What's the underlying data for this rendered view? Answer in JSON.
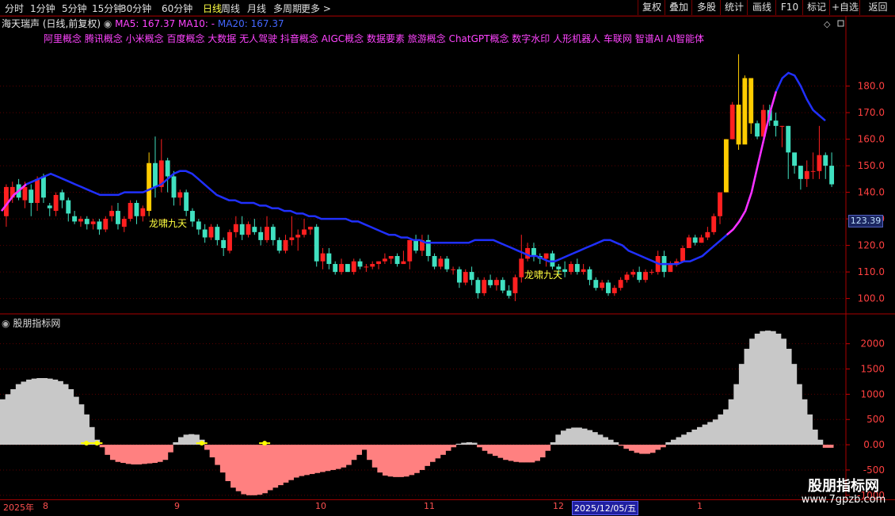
{
  "toolbar": {
    "periods": [
      "分时",
      "1分钟",
      "5分钟",
      "15分钟",
      "30分钟",
      "60分钟",
      "日线",
      "周线",
      "月线",
      "多周期",
      "更多"
    ],
    "active_period": "日线",
    "tools": [
      "复权",
      "叠加",
      "多股",
      "统计",
      "画线",
      "F10",
      "标记",
      "+自选",
      "返回"
    ]
  },
  "header": {
    "stock_name": "海天瑞声",
    "mode": "(日线,前复权)",
    "ma5": "MA5: 167.37",
    "ma10": "MA10: -",
    "ma20": "MA20: 167.37"
  },
  "concepts": "阿里概念 腾讯概念 小米概念 百度概念 大数据 无人驾驶 抖音概念 AIGC概念 数据要素 旅游概念 ChatGPT概念 数字水印 人形机器人 车联网 智谱AI AI智能体",
  "current_price_label": "123.39",
  "annotations": [
    "龙啸九天",
    "龙啸九天"
  ],
  "indicator_title": "股朋指标网",
  "date_axis": {
    "labels": [
      "2025年",
      "8",
      "9",
      "10",
      "11",
      "12",
      "2025/12/05/五",
      "1"
    ],
    "selected": "2025/12/05/五"
  },
  "watermark": {
    "title": "股朋指标网",
    "url": "www.7gpzb.com"
  },
  "chart_data": [
    {
      "type": "candlestick",
      "y_ticks": [
        100,
        110,
        120,
        130,
        140,
        150,
        160,
        170,
        180
      ],
      "y_tick_labels": [
        "100.0",
        "110.0",
        "120.0",
        "130.0",
        "140.0",
        "150.0",
        "160.0",
        "170.0",
        "180.0"
      ],
      "ylim": [
        96,
        196
      ],
      "ma_line": [
        133,
        136,
        139,
        141,
        143,
        144,
        145,
        146,
        147,
        146,
        145,
        144,
        143,
        142,
        141,
        140,
        139,
        139,
        139,
        139,
        140,
        140,
        140,
        140,
        141,
        142,
        143,
        145,
        147,
        148,
        148,
        147,
        145,
        143,
        141,
        139,
        138,
        137,
        137,
        136,
        136,
        136,
        135,
        135,
        134,
        134,
        133,
        133,
        132,
        132,
        131,
        131,
        130,
        130,
        130,
        130,
        130,
        129,
        129,
        128,
        127,
        126,
        125,
        124,
        124,
        123,
        123,
        122,
        122,
        121,
        121,
        121,
        121,
        121,
        121,
        121,
        121,
        122,
        122,
        122,
        122,
        121,
        120,
        119,
        118,
        117,
        116,
        116,
        115,
        114,
        114,
        115,
        116,
        117,
        118,
        119,
        120,
        121,
        122,
        122,
        121,
        120,
        118,
        117,
        116,
        115,
        114,
        113,
        113,
        113,
        113,
        114,
        114,
        115,
        116,
        118,
        120,
        122,
        124,
        126,
        129,
        133,
        140,
        150,
        160,
        170,
        178,
        183,
        185,
        184,
        180,
        175,
        171,
        169,
        167
      ],
      "candles": [
        [
          131,
          142,
          127,
          143
        ],
        [
          138,
          142,
          136,
          144
        ],
        [
          143,
          138,
          137,
          145
        ],
        [
          137,
          142,
          134,
          144
        ],
        [
          141,
          136,
          131,
          143
        ],
        [
          136,
          145,
          133,
          146
        ],
        [
          146,
          138,
          136,
          147
        ],
        [
          135,
          134,
          131,
          136
        ],
        [
          133,
          139,
          131,
          140
        ],
        [
          140,
          137,
          134,
          141
        ],
        [
          137,
          132,
          129,
          138
        ],
        [
          131,
          129,
          128,
          133
        ],
        [
          129,
          130,
          127,
          131
        ],
        [
          130,
          128,
          126,
          131
        ],
        [
          128,
          129,
          126,
          130
        ],
        [
          129,
          126,
          124,
          130
        ],
        [
          126,
          130,
          125,
          131
        ],
        [
          131,
          133,
          129,
          135
        ],
        [
          133,
          128,
          126,
          136
        ],
        [
          127,
          130,
          125,
          131
        ],
        [
          130,
          136,
          129,
          137
        ],
        [
          136,
          131,
          128,
          137
        ],
        [
          131,
          134,
          129,
          135
        ],
        [
          133,
          151,
          131,
          155
        ],
        [
          151,
          142,
          138,
          161
        ],
        [
          142,
          152,
          140,
          160
        ],
        [
          152,
          146,
          140,
          153
        ],
        [
          146,
          138,
          135,
          148
        ],
        [
          138,
          140,
          135,
          141
        ],
        [
          140,
          133,
          131,
          141
        ],
        [
          133,
          129,
          127,
          134
        ],
        [
          129,
          126,
          124,
          130
        ],
        [
          126,
          123,
          121,
          128
        ],
        [
          123,
          127,
          122,
          128
        ],
        [
          127,
          122,
          120,
          128
        ],
        [
          122,
          119,
          116,
          123
        ],
        [
          118,
          125,
          117,
          126
        ],
        [
          125,
          128,
          123,
          131
        ],
        [
          128,
          124,
          122,
          131
        ],
        [
          124,
          128,
          123,
          129
        ],
        [
          127,
          125,
          124,
          130
        ],
        [
          125,
          122,
          120,
          127
        ],
        [
          122,
          127,
          121,
          131
        ],
        [
          127,
          122,
          120,
          128
        ],
        [
          122,
          118,
          117,
          123
        ],
        [
          118,
          122,
          117,
          124
        ],
        [
          122,
          123,
          120,
          131
        ],
        [
          123,
          124,
          118,
          126
        ],
        [
          124,
          126,
          123,
          130
        ],
        [
          126,
          127,
          124,
          127
        ],
        [
          127,
          114,
          112,
          128
        ],
        [
          114,
          117,
          111,
          119
        ],
        [
          117,
          113,
          111,
          119
        ],
        [
          113,
          110,
          109,
          114
        ],
        [
          110,
          113,
          109,
          115
        ],
        [
          113,
          110,
          110,
          112
        ],
        [
          110,
          114,
          109,
          115
        ],
        [
          114,
          112,
          111,
          115
        ],
        [
          112,
          112,
          110,
          113
        ],
        [
          112,
          113,
          111,
          114
        ],
        [
          113,
          114,
          111,
          114
        ],
        [
          114,
          115,
          113,
          117
        ],
        [
          115,
          116,
          113,
          116
        ],
        [
          116,
          113,
          112,
          117
        ],
        [
          113,
          114,
          113,
          118
        ],
        [
          114,
          122,
          111,
          122
        ],
        [
          122,
          118,
          117,
          124
        ],
        [
          118,
          122,
          116,
          124
        ],
        [
          122,
          116,
          114,
          124
        ],
        [
          116,
          112,
          111,
          117
        ],
        [
          112,
          115,
          111,
          116
        ],
        [
          115,
          111,
          110,
          116
        ],
        [
          111,
          111,
          109,
          112
        ],
        [
          111,
          106,
          104,
          112
        ],
        [
          106,
          110,
          105,
          111
        ],
        [
          110,
          107,
          105,
          112
        ],
        [
          107,
          102,
          100,
          108
        ],
        [
          102,
          107,
          101,
          108
        ],
        [
          107,
          105,
          104,
          109
        ],
        [
          105,
          107,
          103,
          108
        ],
        [
          107,
          103,
          102,
          108
        ],
        [
          103,
          101,
          100,
          105
        ],
        [
          102,
          108,
          99,
          109
        ],
        [
          108,
          115,
          106,
          124
        ],
        [
          115,
          119,
          114,
          121
        ],
        [
          119,
          116,
          114,
          121
        ],
        [
          116,
          115,
          113,
          117
        ],
        [
          115,
          117,
          112,
          117
        ],
        [
          117,
          112,
          111,
          118
        ],
        [
          112,
          111,
          109,
          113
        ],
        [
          111,
          110,
          108,
          114
        ],
        [
          110,
          113,
          109,
          114
        ],
        [
          113,
          110,
          109,
          115
        ],
        [
          110,
          111,
          109,
          113
        ],
        [
          111,
          107,
          105,
          112
        ],
        [
          107,
          104,
          103,
          108
        ],
        [
          104,
          106,
          103,
          107
        ],
        [
          106,
          102,
          101,
          107
        ],
        [
          102,
          104,
          101,
          105
        ],
        [
          104,
          107,
          103,
          108
        ],
        [
          107,
          109,
          106,
          110
        ],
        [
          109,
          110,
          108,
          111
        ],
        [
          110,
          107,
          106,
          112
        ],
        [
          107,
          110,
          106,
          111
        ],
        [
          110,
          110,
          109,
          111
        ],
        [
          110,
          116,
          109,
          118
        ],
        [
          116,
          110,
          108,
          118
        ],
        [
          110,
          113,
          110,
          114
        ],
        [
          113,
          114,
          112,
          115
        ],
        [
          114,
          119,
          114,
          120
        ],
        [
          119,
          123,
          119,
          124
        ],
        [
          123,
          121,
          120,
          124
        ],
        [
          121,
          123,
          121,
          124
        ],
        [
          123,
          125,
          122,
          127
        ],
        [
          125,
          131,
          124,
          132
        ],
        [
          131,
          140,
          128,
          132
        ],
        [
          140,
          160,
          140,
          160
        ],
        [
          160,
          173,
          160,
          174
        ],
        [
          173,
          158,
          156,
          192
        ],
        [
          158,
          183,
          160,
          184
        ],
        [
          183,
          166,
          162,
          171
        ],
        [
          166,
          161,
          160,
          167
        ],
        [
          161,
          171,
          160,
          173
        ],
        [
          171,
          167,
          165,
          173
        ],
        [
          167,
          165,
          161,
          170
        ],
        [
          165,
          165,
          157,
          165
        ],
        [
          165,
          155,
          145,
          165
        ],
        [
          155,
          150,
          147,
          154
        ],
        [
          150,
          145,
          141,
          150
        ],
        [
          145,
          148,
          142,
          152
        ],
        [
          148,
          148,
          145,
          155
        ],
        [
          148,
          154,
          145,
          165
        ],
        [
          154,
          150,
          145,
          155
        ],
        [
          150,
          143,
          142,
          155
        ]
      ]
    },
    {
      "type": "histogram",
      "y_ticks": [
        -1000,
        -500,
        0,
        500,
        1000,
        1500,
        2000
      ],
      "y_tick_labels": [
        "-1000",
        "-500",
        "0.00",
        "500",
        "1000",
        "1500",
        "2000"
      ],
      "ylim": [
        -1050,
        2450
      ],
      "values": [
        900,
        1000,
        1100,
        1200,
        1250,
        1290,
        1310,
        1320,
        1320,
        1310,
        1290,
        1260,
        1200,
        1100,
        950,
        800,
        600,
        350,
        100,
        -50,
        -200,
        -300,
        -340,
        -360,
        -380,
        -390,
        -390,
        -380,
        -370,
        -360,
        -340,
        -300,
        -150,
        50,
        150,
        200,
        210,
        200,
        100,
        -100,
        -250,
        -400,
        -550,
        -720,
        -850,
        -920,
        -980,
        -1000,
        -1000,
        -990,
        -960,
        -900,
        -850,
        -800,
        -750,
        -700,
        -650,
        -620,
        -600,
        -580,
        -560,
        -540,
        -520,
        -500,
        -480,
        -450,
        -400,
        -300,
        -200,
        -100,
        -300,
        -450,
        -550,
        -610,
        -630,
        -640,
        -640,
        -630,
        -600,
        -560,
        -500,
        -420,
        -340,
        -270,
        -200,
        -120,
        -50,
        20,
        40,
        50,
        40,
        -50,
        -120,
        -180,
        -220,
        -260,
        -300,
        -320,
        -340,
        -350,
        -350,
        -350,
        -320,
        -250,
        -120,
        50,
        200,
        280,
        320,
        340,
        340,
        320,
        290,
        250,
        200,
        150,
        100,
        50,
        -20,
        -80,
        -120,
        -160,
        -180,
        -180,
        -160,
        -100,
        -50,
        50,
        100,
        150,
        200,
        250,
        300,
        350,
        400,
        450,
        500,
        600,
        700,
        900,
        1200,
        1600,
        1900,
        2100,
        2200,
        2250,
        2260,
        2250,
        2200,
        2100,
        1900,
        1600,
        1200,
        900,
        600,
        300,
        100,
        -60,
        -60
      ],
      "markers": [
        16,
        18,
        38,
        50
      ]
    }
  ]
}
